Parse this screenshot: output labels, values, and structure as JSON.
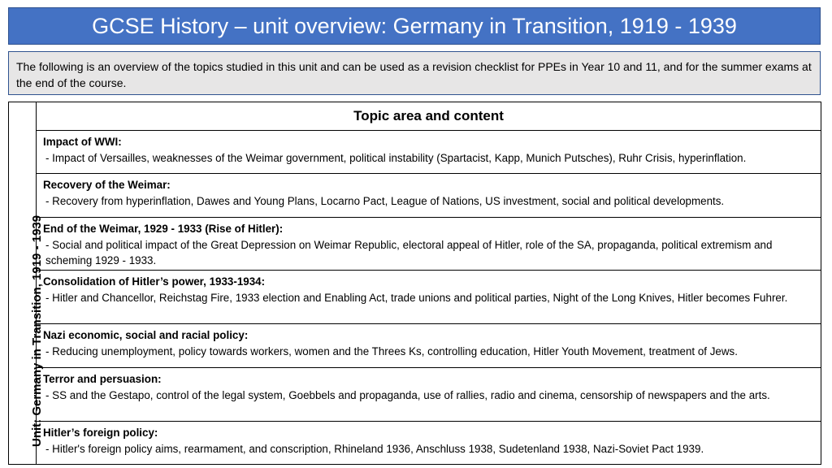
{
  "title": "GCSE History – unit overview: Germany in Transition, 1919 - 1939",
  "intro": "The following is an overview of the topics studied in this unit and can be used as a revision checklist for PPEs in Year 10 and 11, and for the summer exams at the end of the course.",
  "unit_label": "Unit: Germany in Transition, 1919 - 1939",
  "table_header": "Topic area and content",
  "topics": [
    {
      "heading": "Impact of WWI:",
      "content": "- Impact of Versailles, weaknesses of the Weimar government, political instability (Spartacist, Kapp, Munich Putsches), Ruhr Crisis, hyperinflation."
    },
    {
      "heading": "Recovery of the Weimar:",
      "content": "- Recovery from hyperinflation, Dawes and Young Plans, Locarno Pact, League of Nations, US investment, social and political developments."
    },
    {
      "heading": "End of the Weimar, 1929 - 1933 (Rise of Hitler):",
      "content": "- Social and political impact of the Great Depression on Weimar Republic, electoral appeal of Hitler, role of the SA, propaganda, political extremism and scheming 1929 - 1933."
    },
    {
      "heading": "Consolidation of Hitler’s power, 1933-1934:",
      "content": "- Hitler and Chancellor, Reichstag Fire, 1933 election and Enabling Act, trade unions and political parties, Night of the Long Knives, Hitler becomes Fuhrer."
    },
    {
      "heading": "Nazi economic, social and racial policy:",
      "content": "- Reducing unemployment, policy towards workers, women and the Threes Ks, controlling education, Hitler Youth Movement, treatment of Jews."
    },
    {
      "heading": "Terror and persuasion:",
      "content": "- SS and the Gestapo, control of the legal system, Goebbels and propaganda, use of rallies, radio and cinema, censorship of newspapers and the arts."
    },
    {
      "heading": "Hitler’s foreign policy:",
      "content": "- Hitler's foreign policy aims, rearmament, and conscription, Rhineland 1936, Anschluss 1938, Sudetenland 1938, Nazi-Soviet Pact 1939."
    }
  ]
}
